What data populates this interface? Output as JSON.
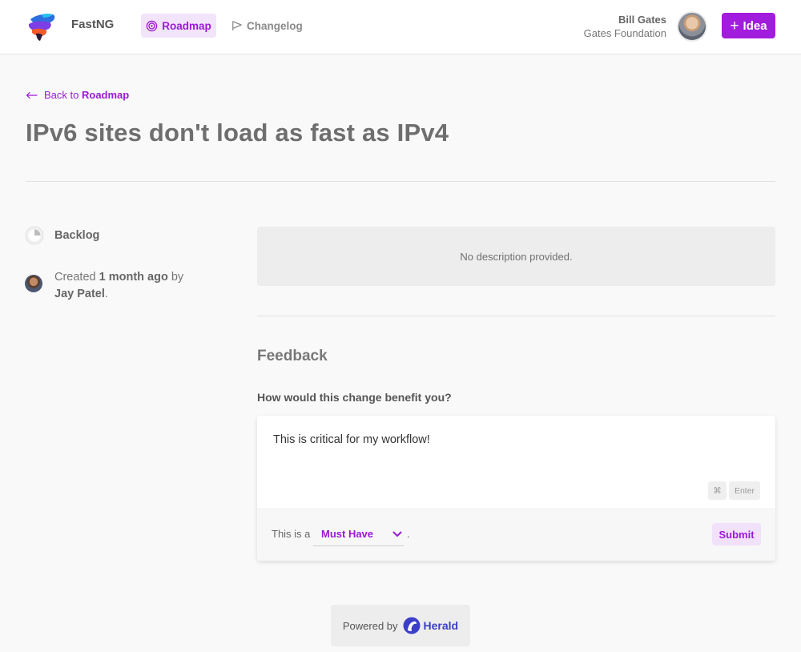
{
  "header": {
    "brand": "FastNG",
    "nav": {
      "roadmap": "Roadmap",
      "changelog": "Changelog"
    },
    "user": {
      "name": "Bill Gates",
      "org": "Gates Foundation"
    },
    "idea_button": "Idea"
  },
  "back": {
    "prefix": "Back to",
    "target": "Roadmap"
  },
  "post": {
    "title": "IPv6 sites don't load as fast as IPv4",
    "status": "Backlog",
    "created_prefix": "Created",
    "created_when": "1 month ago",
    "created_by_word": "by",
    "author": "Jay Patel",
    "description": "No description provided."
  },
  "feedback": {
    "title": "Feedback",
    "question": "How would this change benefit you?",
    "text": "This is critical for my workflow!",
    "shortcut_cmd": "⌘",
    "shortcut_enter": "Enter",
    "this_is_a": "This is a",
    "priority": "Must Have",
    "period": ".",
    "submit": "Submit"
  },
  "footer": {
    "powered_by": "Powered by",
    "herald": "Herald"
  },
  "colors": {
    "accent": "#a21cde",
    "accent_light": "#f2e4fb",
    "herald": "#3b3fc8"
  }
}
